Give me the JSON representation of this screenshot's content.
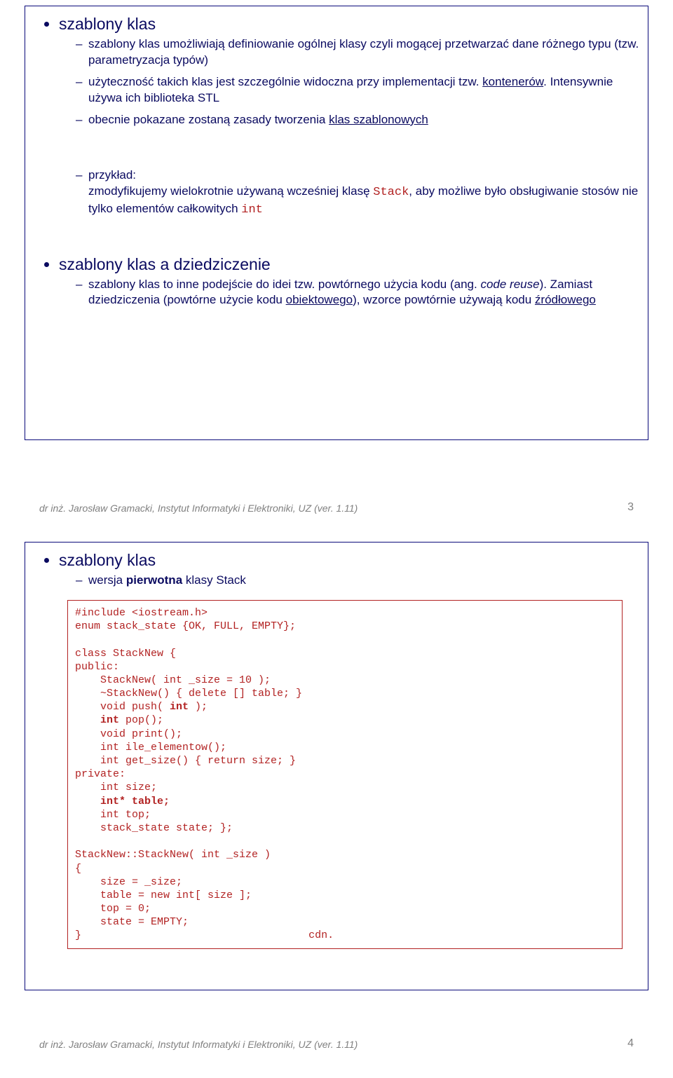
{
  "slide1": {
    "h1": "szablony klas",
    "b1": "szablony klas umożliwiają definiowanie ogólnej klasy czyli mogącej przetwarzać dane różnego typu (tzw. parametryzacja typów)",
    "b2a": "użyteczność takich klas jest szczególnie widoczna przy implementacji tzw. ",
    "b2b": "kontenerów",
    "b2c": ". Intensywnie używa ich biblioteka STL",
    "b3a": "obecnie pokazane zostaną zasady tworzenia ",
    "b3b": "klas szablonowych",
    "b4a": "przykład:",
    "b4b": "zmodyfikujemy wielokrotnie używaną wcześniej klasę ",
    "b4c": "Stack",
    "b4d": ", aby możliwe było obsługiwanie stosów nie tylko elementów całkowitych ",
    "b4e": "int",
    "h2": "szablony klas a dziedziczenie",
    "c1a": "szablony klas to inne podejście do idei tzw. powtórnego użycia kodu (ang. ",
    "c1b": "code reuse",
    "c1c": "). Zamiast dziedziczenia (powtórne użycie kodu ",
    "c1d": "obiektowego",
    "c1e": "), wzorce powtórnie używają kodu ",
    "c1f": "źródłowego",
    "footer": "dr inż. Jarosław Gramacki, Instytut Informatyki i Elektroniki, UZ (ver. 1.11)",
    "page": "3"
  },
  "slide2": {
    "h1": "szablony klas",
    "b1a": "wersja ",
    "b1b": "pierwotna",
    "b1c": " klasy Stack",
    "code_l1": "#include <iostream.h>",
    "code_l2": "enum stack_state {OK, FULL, EMPTY};",
    "code_l3": "class StackNew {",
    "code_l4": "public:",
    "code_l5a": "    StackNew( int _size = 10 );",
    "code_l6": "    ~StackNew() { delete [] table; }",
    "code_l7a": "    void push( ",
    "code_l7b": "int",
    "code_l7c": " );",
    "code_l8a": "    ",
    "code_l8b": "int",
    "code_l8c": " pop();",
    "code_l9": "    void print();",
    "code_l10": "    int ile_elementow();",
    "code_l11": "    int get_size() { return size; }",
    "code_l12": "private:",
    "code_l13": "    int size;",
    "code_l14a": "    ",
    "code_l14b": "int* table;",
    "code_l15": "    int top;",
    "code_l16": "    stack_state state; };",
    "code_l17": "StackNew::StackNew( int _size )",
    "code_l18": "{",
    "code_l19": "    size = _size;",
    "code_l20": "    table = new int[ size ];",
    "code_l21": "    top = 0;",
    "code_l22": "    state = EMPTY;",
    "code_l23a": "}",
    "code_l23b": "                                    cdn.",
    "footer": "dr inż. Jarosław Gramacki, Instytut Informatyki i Elektroniki, UZ (ver. 1.11)",
    "page": "4"
  }
}
